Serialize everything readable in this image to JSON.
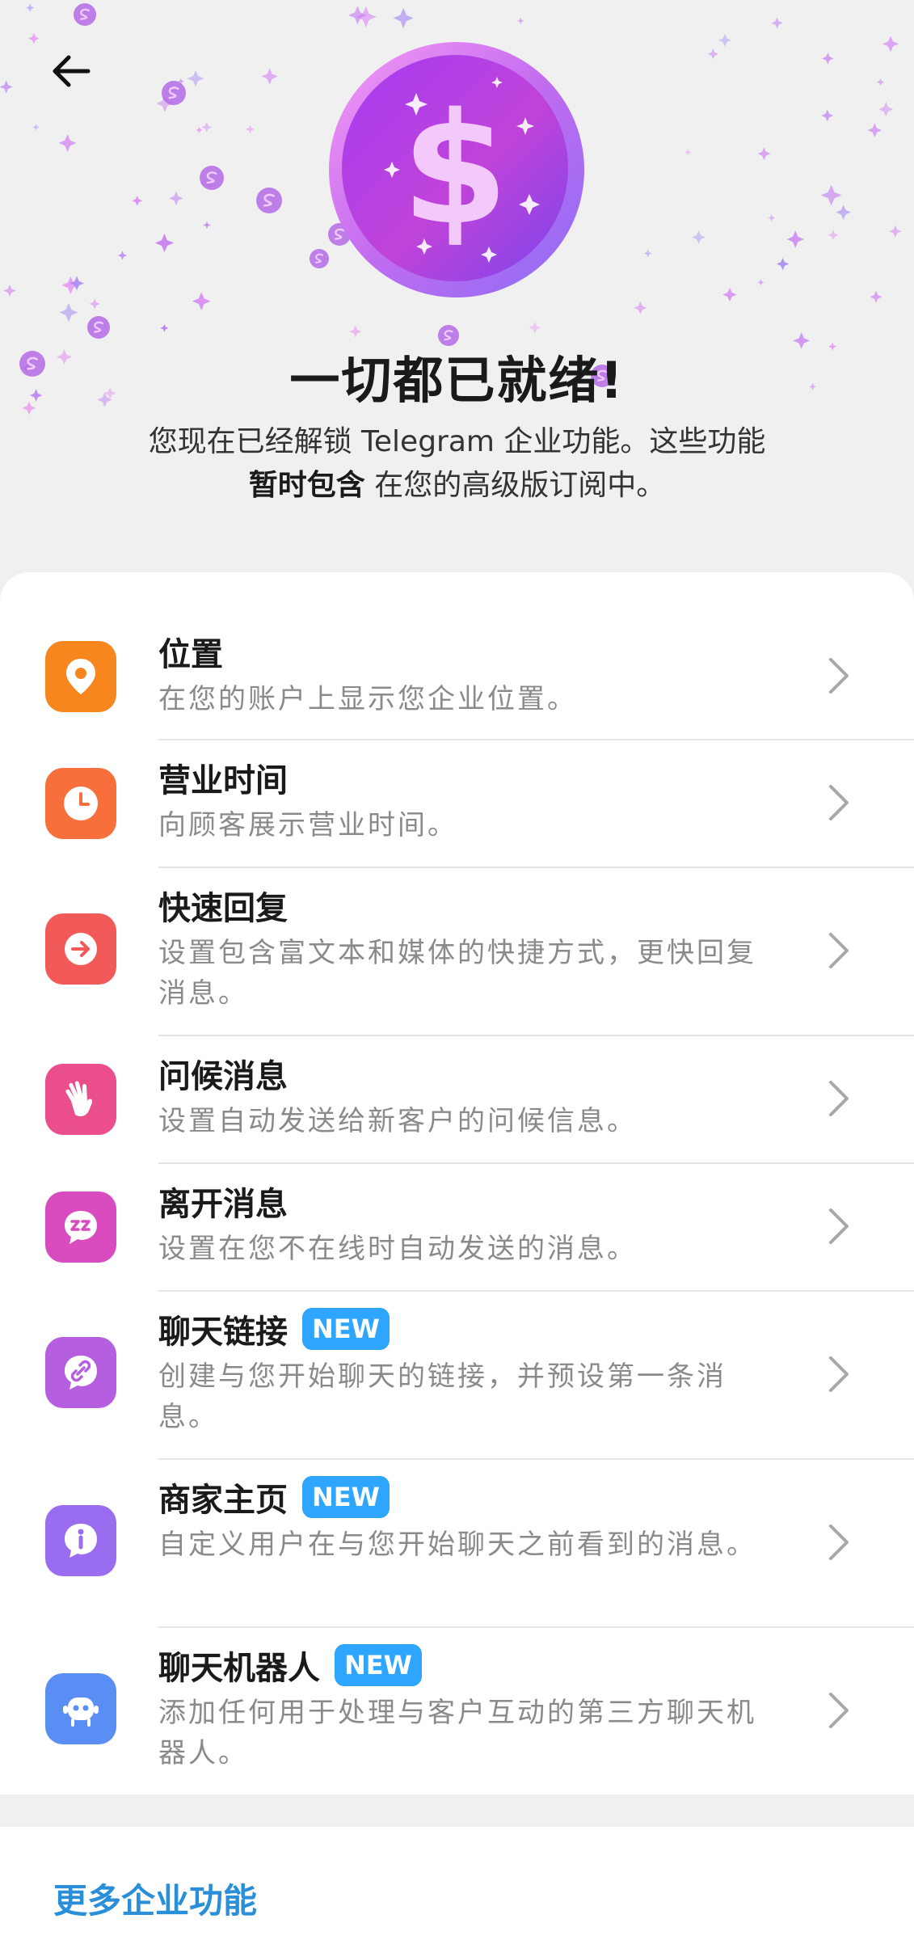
{
  "header": {
    "back_icon": "arrow-left-icon",
    "hero_icon": "dollar-coin-icon",
    "title": "一切都已就绪!",
    "desc_line1": "您现在已经解锁 Telegram 企业功能。这些功能",
    "desc_bold": "暂时包含",
    "desc_rest": " 在您的高级版订阅中。"
  },
  "features": [
    {
      "title": "位置",
      "desc": "在您的账户上显示您企业位置。",
      "icon": "location-pin-icon",
      "color": "#f7861f"
    },
    {
      "title": "营业时间",
      "desc": "向顾客展示营业时间。",
      "icon": "clock-icon",
      "color": "#f76f3b"
    },
    {
      "title": "快速回复",
      "desc": "设置包含富文本和媒体的快捷方式，更快回复消息。",
      "icon": "quick-reply-arrow-icon",
      "color": "#f25a5a"
    },
    {
      "title": "问候消息",
      "desc": "设置自动发送给新客户的问候信息。",
      "icon": "waving-hand-icon",
      "color": "#ea4f8c"
    },
    {
      "title": "离开消息",
      "desc": "设置在您不在线时自动发送的消息。",
      "icon": "sleep-zz-icon",
      "color": "#d94cc0"
    },
    {
      "title": "聊天链接",
      "badge": "NEW",
      "desc": "创建与您开始聊天的链接，并预设第一条消息。",
      "icon": "chat-link-icon",
      "color": "#b55ee0"
    },
    {
      "title": "商家主页",
      "badge": "NEW",
      "desc": "自定义用户在与您开始聊天之前看到的消息。",
      "icon": "info-icon",
      "color": "#9a6cf0"
    },
    {
      "title": "聊天机器人",
      "badge": "NEW",
      "desc": "添加任何用于处理与客户互动的第三方聊天机器人。",
      "icon": "chatbot-icon",
      "color": "#5a8ef5"
    }
  ],
  "footer": {
    "more_label": "更多企业功能"
  }
}
